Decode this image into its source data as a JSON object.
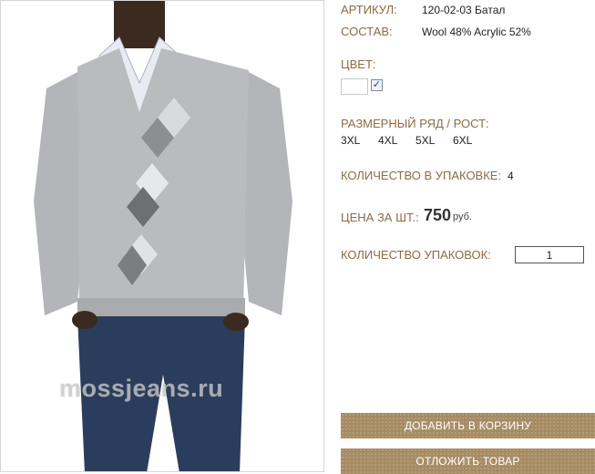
{
  "product": {
    "article_label": "АРТИКУЛ:",
    "article_value": "120-02-03 Батал",
    "composition_label": "СОСТАВ:",
    "composition_value": "Wool 48% Acrylic 52%",
    "color_label": "ЦВЕТ:",
    "color_swatch": "#ffffff",
    "color_checked": "✓",
    "sizes_label": "РАЗМЕРНЫЙ РЯД / РОСТ:",
    "sizes": [
      "3XL",
      "4XL",
      "5XL",
      "6XL"
    ],
    "pack_qty_label": "КОЛИЧЕСТВО В УПАКОВКЕ:",
    "pack_qty_value": "4",
    "price_label": "ЦЕНА ЗА ШТ.:",
    "price_value": "750",
    "price_unit": "руб.",
    "packs_label": "КОЛИЧЕСТВО УПАКОВОК:",
    "packs_value": "1"
  },
  "photo": {
    "watermark": "mossjeans.ru"
  },
  "buttons": {
    "add_to_cart": "ДОБАВИТЬ В КОРЗИНУ",
    "defer": "ОТЛОЖИТЬ ТОВАР"
  },
  "colors": {
    "label": "#8d6a45",
    "button": "#a68b63",
    "sweater": "#b7b9bc",
    "jeans": "#2b3d5c"
  }
}
